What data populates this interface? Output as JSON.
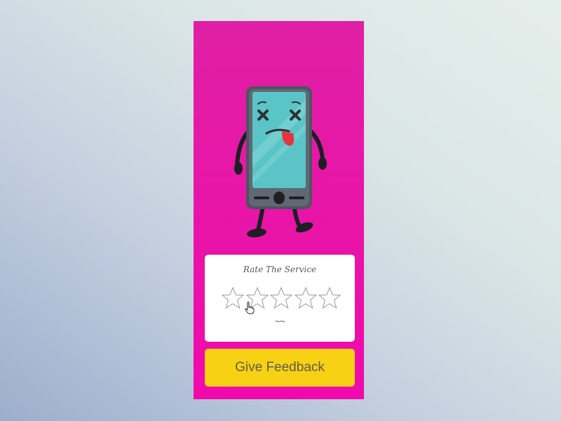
{
  "colors": {
    "panel_top": "#e020a4",
    "panel_bottom": "#f00aac",
    "card_bg": "#ffffff",
    "button_bg": "#f7d113",
    "button_text": "#5f5c4d",
    "star_outline": "#9a9a9a"
  },
  "illustration": {
    "icon": "dizzy-phone-mascot-icon"
  },
  "rating": {
    "title": "Rate The Service",
    "face": "~~",
    "max_stars": 5,
    "selected_stars": 0,
    "star_icon": "star-outline-icon",
    "cursor_icon": "hand-pointer-icon"
  },
  "actions": {
    "feedback_label": "Give Feedback"
  }
}
